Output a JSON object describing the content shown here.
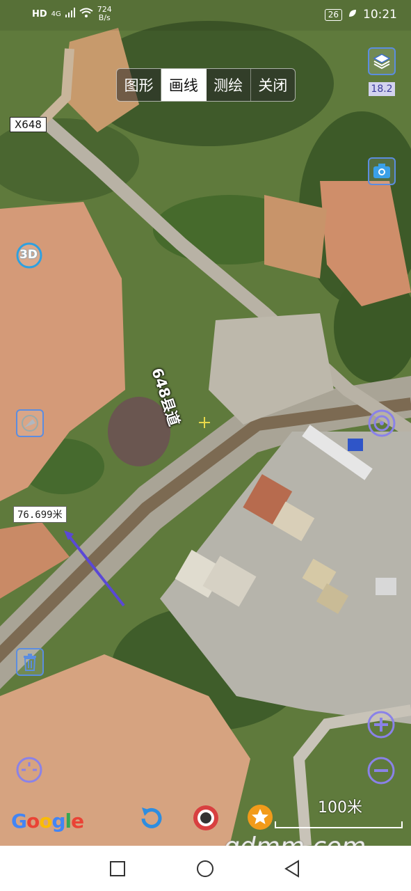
{
  "status_bar": {
    "hd": "HD",
    "network": "4G",
    "rate_value": "724",
    "rate_unit": "B/s",
    "battery": "26",
    "time": "10:21"
  },
  "mode_tabs": [
    {
      "label": "图形",
      "active": false
    },
    {
      "label": "画线",
      "active": true
    },
    {
      "label": "测绘",
      "active": false
    },
    {
      "label": "关闭",
      "active": false
    }
  ],
  "map": {
    "road_label": "X648",
    "road_name": "648县道",
    "distance_label": "76.699米",
    "zoom_level": "18.2",
    "scale_label": "100米",
    "provider": "Google",
    "watermark": "gdmm.com"
  },
  "controls": {
    "three_d": "3D"
  },
  "colors": {
    "accent_blue": "#5b8de0",
    "measure_line": "#5a48d6",
    "zoom_purple": "#8a82e8"
  }
}
